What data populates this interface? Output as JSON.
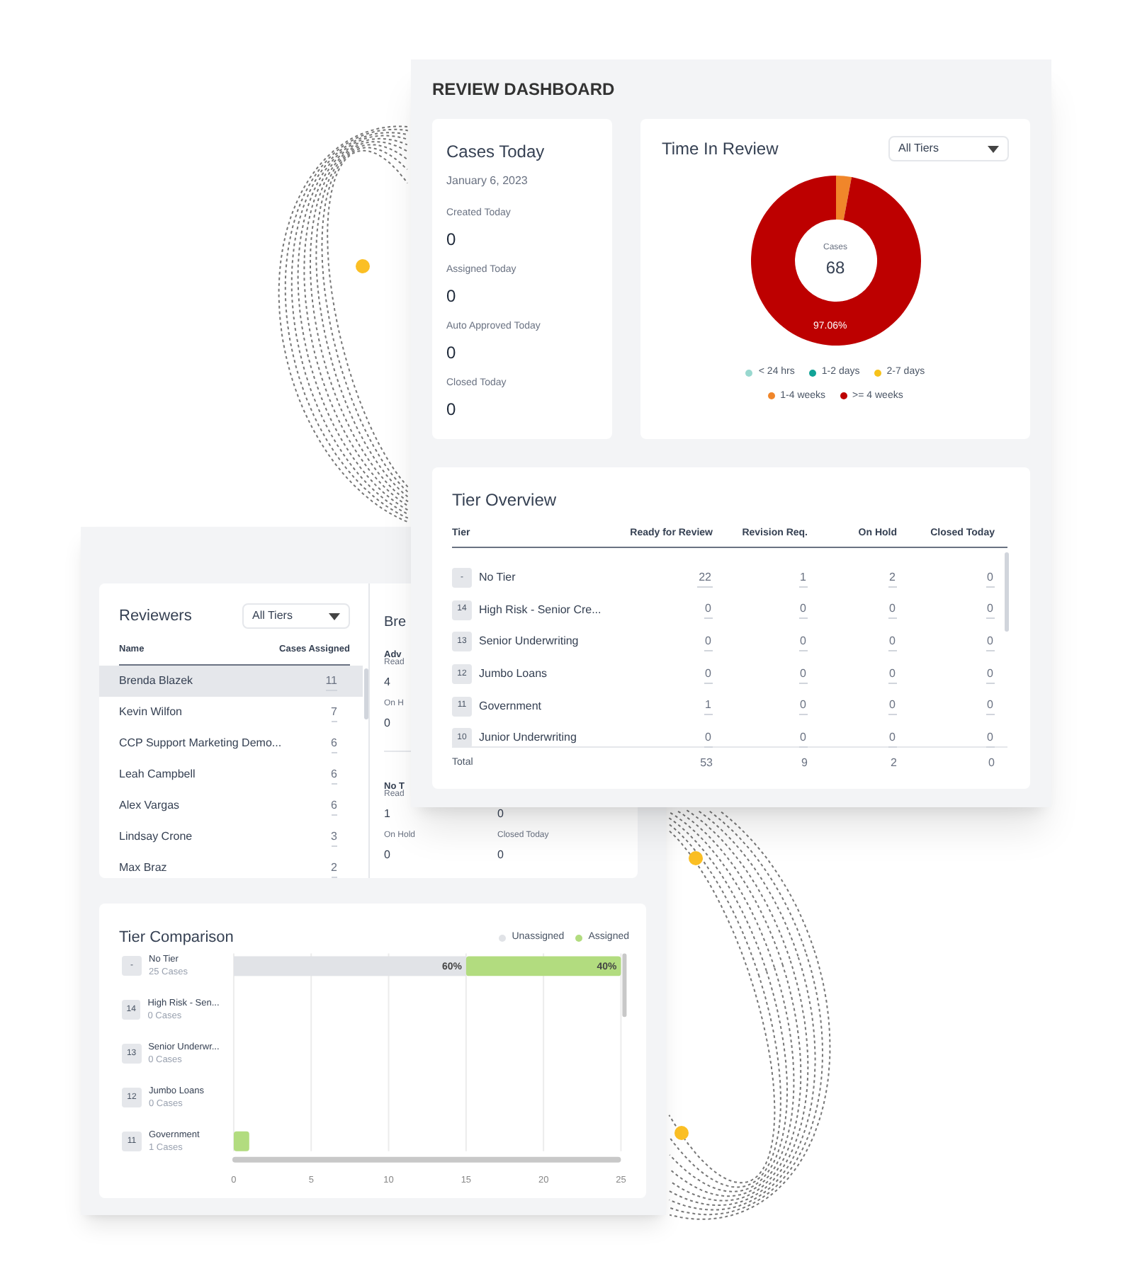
{
  "dashboard": {
    "title": "REVIEW DASHBOARD",
    "cases_today": {
      "title": "Cases Today",
      "date": "January 6, 2023",
      "stats": [
        {
          "label": "Created Today",
          "value": "0"
        },
        {
          "label": "Assigned Today",
          "value": "0"
        },
        {
          "label": "Auto Approved Today",
          "value": "0"
        },
        {
          "label": "Closed Today",
          "value": "0"
        }
      ]
    },
    "time_in_review": {
      "title": "Time In Review",
      "filter": "All Tiers",
      "center_value": "68",
      "chart_data": {
        "type": "donut",
        "categories": [
          "< 24 hrs",
          "1-2 days",
          "2-7 days",
          "1-4 weeks",
          ">= 4 weeks"
        ],
        "series": [
          {
            "name": "Cases",
            "values": [
              0,
              0,
              0,
              2.94,
              97.06
            ]
          }
        ],
        "colors": [
          "#99d8cf",
          "#12a397",
          "#f7c21b",
          "#f0862a",
          "#bd0000"
        ],
        "value_labels": [
          null,
          null,
          null,
          null,
          "97.06%"
        ]
      }
    },
    "tier_overview": {
      "title": "Tier Overview",
      "columns": [
        "Tier",
        "Ready for Review",
        "Revision Req.",
        "On Hold",
        "Closed Today"
      ],
      "rows": [
        {
          "badge": "-",
          "name": "No Tier",
          "values": [
            "22",
            "1",
            "2",
            "0"
          ]
        },
        {
          "badge": "14",
          "name": "High Risk - Senior Cre...",
          "values": [
            "0",
            "0",
            "0",
            "0"
          ]
        },
        {
          "badge": "13",
          "name": "Senior Underwriting",
          "values": [
            "0",
            "0",
            "0",
            "0"
          ]
        },
        {
          "badge": "12",
          "name": "Jumbo Loans",
          "values": [
            "0",
            "0",
            "0",
            "0"
          ]
        },
        {
          "badge": "11",
          "name": "Government",
          "values": [
            "1",
            "0",
            "0",
            "0"
          ]
        },
        {
          "badge": "10",
          "name": "Junior Underwriting",
          "values": [
            "0",
            "0",
            "0",
            "0"
          ]
        }
      ],
      "total": {
        "label": "Total",
        "values": [
          "53",
          "9",
          "2",
          "0"
        ]
      }
    }
  },
  "reviewer_window": {
    "reviewers": {
      "title": "Reviewers",
      "filter": "All Tiers",
      "columns": [
        "Name",
        "Cases Assigned"
      ],
      "rows": [
        {
          "name": "Brenda Blazek",
          "count": "11",
          "selected": true
        },
        {
          "name": "Kevin Wilfon",
          "count": "7",
          "selected": false
        },
        {
          "name": "CCP Support Marketing Demo...",
          "count": "6",
          "selected": false
        },
        {
          "name": "Leah Campbell",
          "count": "6",
          "selected": false
        },
        {
          "name": "Alex Vargas",
          "count": "6",
          "selected": false
        },
        {
          "name": "Lindsay Crone",
          "count": "3",
          "selected": false
        },
        {
          "name": "Max Braz",
          "count": "2",
          "selected": false
        }
      ]
    },
    "breakdown": {
      "title": "Bre",
      "groups": [
        {
          "title": "Adv",
          "rows": [
            [
              {
                "label": "Read",
                "value": "4"
              }
            ],
            [
              {
                "label": "On H",
                "value": "0"
              }
            ]
          ]
        },
        {
          "title": "No T",
          "rows": [
            [
              {
                "label": "Read",
                "value": "1"
              },
              {
                "value": "0"
              }
            ],
            [
              {
                "label": "On Hold",
                "value": "0"
              },
              {
                "label": "Closed Today",
                "value": "0"
              }
            ]
          ]
        }
      ]
    },
    "tier_comparison": {
      "title": "Tier Comparison",
      "tier_labels": [
        {
          "badge": "-",
          "cases": "25 Cases"
        },
        {
          "badge": "14",
          "cases": "0 Cases"
        },
        {
          "badge": "13",
          "cases": "0 Cases"
        },
        {
          "badge": "12",
          "cases": "0 Cases"
        },
        {
          "badge": "11",
          "cases": "1 Cases"
        }
      ],
      "chart_data": {
        "type": "bar",
        "orientation": "horizontal",
        "stacked": true,
        "categories": [
          "No Tier",
          "High Risk - Sen...",
          "Senior Underwr...",
          "Jumbo Loans",
          "Government"
        ],
        "series": [
          {
            "name": "Unassigned",
            "color": "#e1e3e7",
            "values": [
              15,
              0,
              0,
              0,
              0
            ]
          },
          {
            "name": "Assigned",
            "color": "#b2dc7f",
            "values": [
              10,
              0,
              0,
              0,
              1
            ]
          }
        ],
        "xlim": [
          0,
          25
        ],
        "xticks": [
          0,
          5,
          10,
          15,
          20,
          25
        ],
        "grid": true,
        "value_labels": [
          [
            "60%",
            null,
            null,
            null,
            null
          ],
          [
            "40%",
            null,
            null,
            null,
            null
          ]
        ]
      }
    }
  }
}
